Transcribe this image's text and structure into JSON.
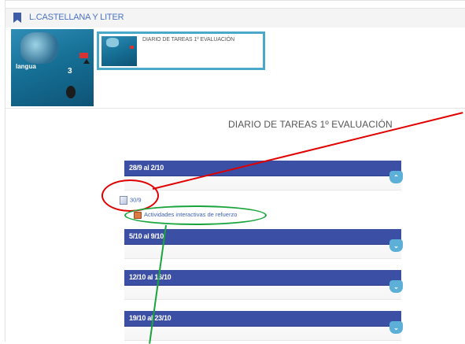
{
  "course": {
    "title": "L.CASTELLANA Y LITER"
  },
  "cover": {
    "brand": "langua",
    "level": "3"
  },
  "thumbnail": {
    "caption": "DIARIO DE TAREAS 1º EVALUACIÓN"
  },
  "section": {
    "title": "DIARIO DE TAREAS 1º EVALUACIÓN"
  },
  "weeks": [
    {
      "label": "28/9 al 2/10",
      "toggle": "⌃"
    },
    {
      "label": "5/10 al 9/10",
      "toggle": "⌄"
    },
    {
      "label": "12/10 al 16/10",
      "toggle": "⌄"
    },
    {
      "label": "19/10 al 23/10",
      "toggle": "⌄"
    }
  ],
  "items": [
    {
      "label": "30/9",
      "icon": "document-icon"
    },
    {
      "label": "Actividades interactivas de refuerzo",
      "icon": "activity-icon"
    }
  ],
  "annotation_colors": {
    "red": "#e00000",
    "green": "#19a53b"
  }
}
